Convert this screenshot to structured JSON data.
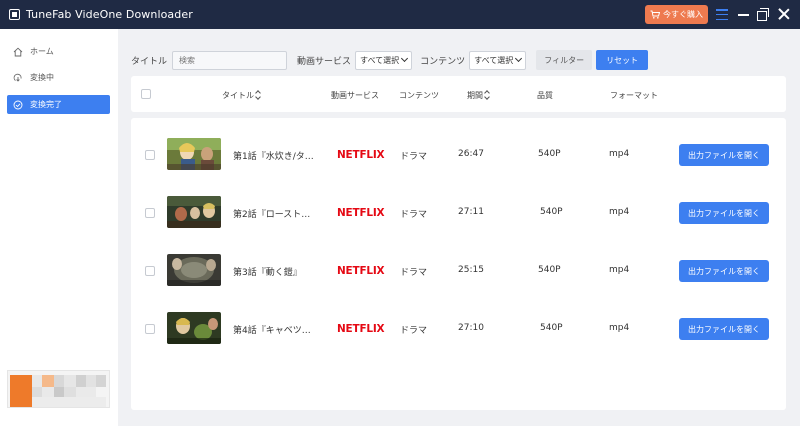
{
  "app": {
    "title": "TuneFab VideOne Downloader",
    "buy_label": "今すぐ購入"
  },
  "sidebar": {
    "items": [
      {
        "label": "ホーム",
        "icon": "home-icon"
      },
      {
        "label": "変換中",
        "icon": "converting-icon"
      },
      {
        "label": "変換完了",
        "icon": "check-circle-icon"
      }
    ]
  },
  "filters": {
    "title_label": "タイトル",
    "search_placeholder": "検索",
    "service_label": "動画サービス",
    "service_value": "すべて選択",
    "content_label": "コンテンツ",
    "content_value": "すべて選択",
    "filter_button": "フィルター",
    "reset_button": "リセット"
  },
  "table": {
    "columns": [
      "タイトル",
      "動画サービス",
      "コンテンツ",
      "期間",
      "品質",
      "フォーマット"
    ],
    "rows": [
      {
        "title": "第1話『水炊き/タ…",
        "service": "NETFLIX",
        "content": "ドラマ",
        "duration": "26:47",
        "quality": "540P",
        "format": "mp4",
        "action": "出力ファイルを開く"
      },
      {
        "title": "第2話『ロースト…",
        "service": "NETFLIX",
        "content": "ドラマ",
        "duration": "27:11",
        "quality": "540P",
        "format": "mp4",
        "action": "出力ファイルを開く"
      },
      {
        "title": "第3話『動く鎧』",
        "service": "NETFLIX",
        "content": "ドラマ",
        "duration": "25:15",
        "quality": "540P",
        "format": "mp4",
        "action": "出力ファイルを開く"
      },
      {
        "title": "第4話『キャベツ…",
        "service": "NETFLIX",
        "content": "ドラマ",
        "duration": "27:10",
        "quality": "540P",
        "format": "mp4",
        "action": "出力ファイルを開く"
      }
    ]
  },
  "colors": {
    "titlebar": "#1f2a44",
    "accent": "#3d7ff0",
    "buy": "#ee7a4f",
    "netflix": "#e50914"
  }
}
